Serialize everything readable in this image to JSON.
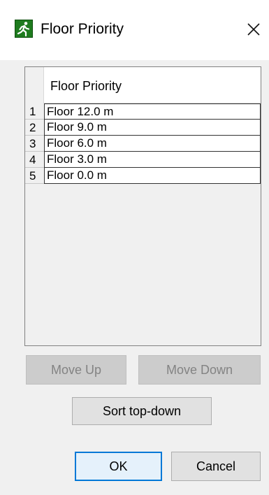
{
  "window": {
    "title": "Floor Priority",
    "icon": "running-man-icon",
    "close_icon": "close-icon"
  },
  "table": {
    "column_header": "Floor Priority",
    "rows": [
      {
        "num": "1",
        "value": "Floor 12.0 m"
      },
      {
        "num": "2",
        "value": "Floor 9.0 m"
      },
      {
        "num": "3",
        "value": "Floor 6.0 m"
      },
      {
        "num": "4",
        "value": "Floor 3.0 m"
      },
      {
        "num": "5",
        "value": "Floor 0.0 m"
      }
    ]
  },
  "buttons": {
    "move_up": "Move Up",
    "move_down": "Move Down",
    "sort_top_down": "Sort top-down",
    "ok": "OK",
    "cancel": "Cancel"
  },
  "colors": {
    "icon_green": "#1e7b1e",
    "default_button_border": "#0078d7",
    "disabled_button_bg": "#cccccc"
  }
}
